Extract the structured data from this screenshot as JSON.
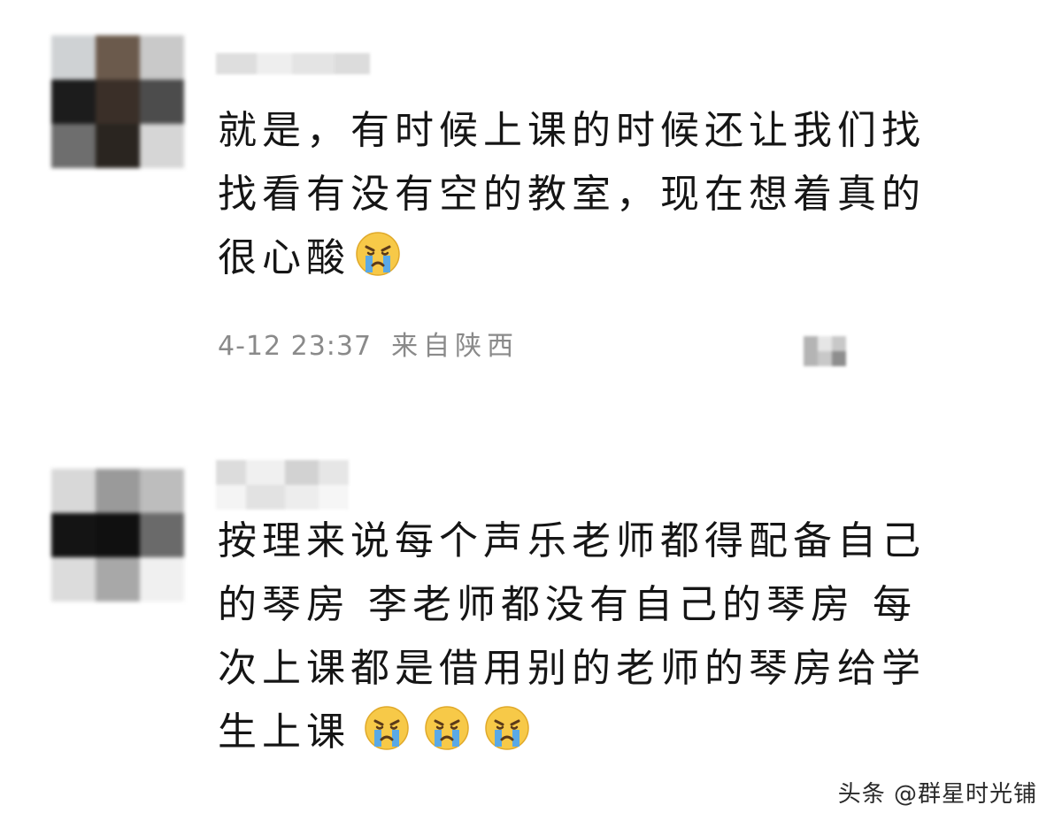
{
  "comments": [
    {
      "lines": [
        "就是，有时候上课的时候还让我们找",
        "找看有没有空的教室，现在想着真的",
        "很心酸"
      ],
      "emojis": [
        "crying-emoji"
      ],
      "time": "4-12 23:37",
      "location": "来自陕西"
    },
    {
      "lines": [
        "按理来说每个声乐老师都得配备自己",
        "的琴房 李老师都没有自己的琴房 每",
        "次上课都是借用别的老师的琴房给学",
        "生上课"
      ],
      "emojis": [
        "crying-emoji",
        "crying-emoji",
        "crying-emoji"
      ]
    }
  ],
  "watermark": "头条 @群星时光铺",
  "colors": {
    "text": "#151515",
    "meta": "#8a8a8a",
    "emoji_face": "#f7c948",
    "emoji_tear": "#5aa9e6"
  }
}
